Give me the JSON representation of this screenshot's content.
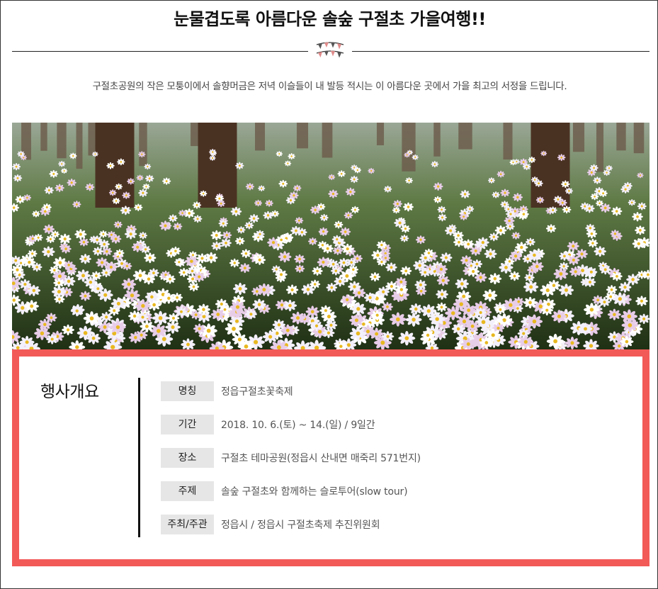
{
  "page": {
    "title": "눈물겹도록 아름다운 솔숲 구절초 가을여행!!",
    "subtitle": "구절초공원의 작은 모퉁이에서 솔향머금은 저녁 이슬들이 내 발등 적시는 이 아름다운 곳에서 가을 최고의 서정을 드립니다."
  },
  "colors": {
    "accent_border": "#f25a58",
    "label_bg": "#e6e6e6"
  },
  "icons": {
    "divider_ornament": "bunting-flags-icon"
  },
  "event": {
    "heading": "행사개요",
    "rows": [
      {
        "label": "명칭",
        "value": "정읍구절초꽃축제"
      },
      {
        "label": "기간",
        "value": "2018. 10. 6.(토) ~ 14.(일) / 9일간"
      },
      {
        "label": "장소",
        "value": "구절초 테마공원(정읍시 산내면 매죽리 571번지)"
      },
      {
        "label": "주제",
        "value": "솔숲 구절초와 함께하는 슬로투어(slow tour)"
      },
      {
        "label": "주최/주관",
        "value": "정읍시 / 정읍시 구절초축제 추진위원회"
      }
    ]
  }
}
